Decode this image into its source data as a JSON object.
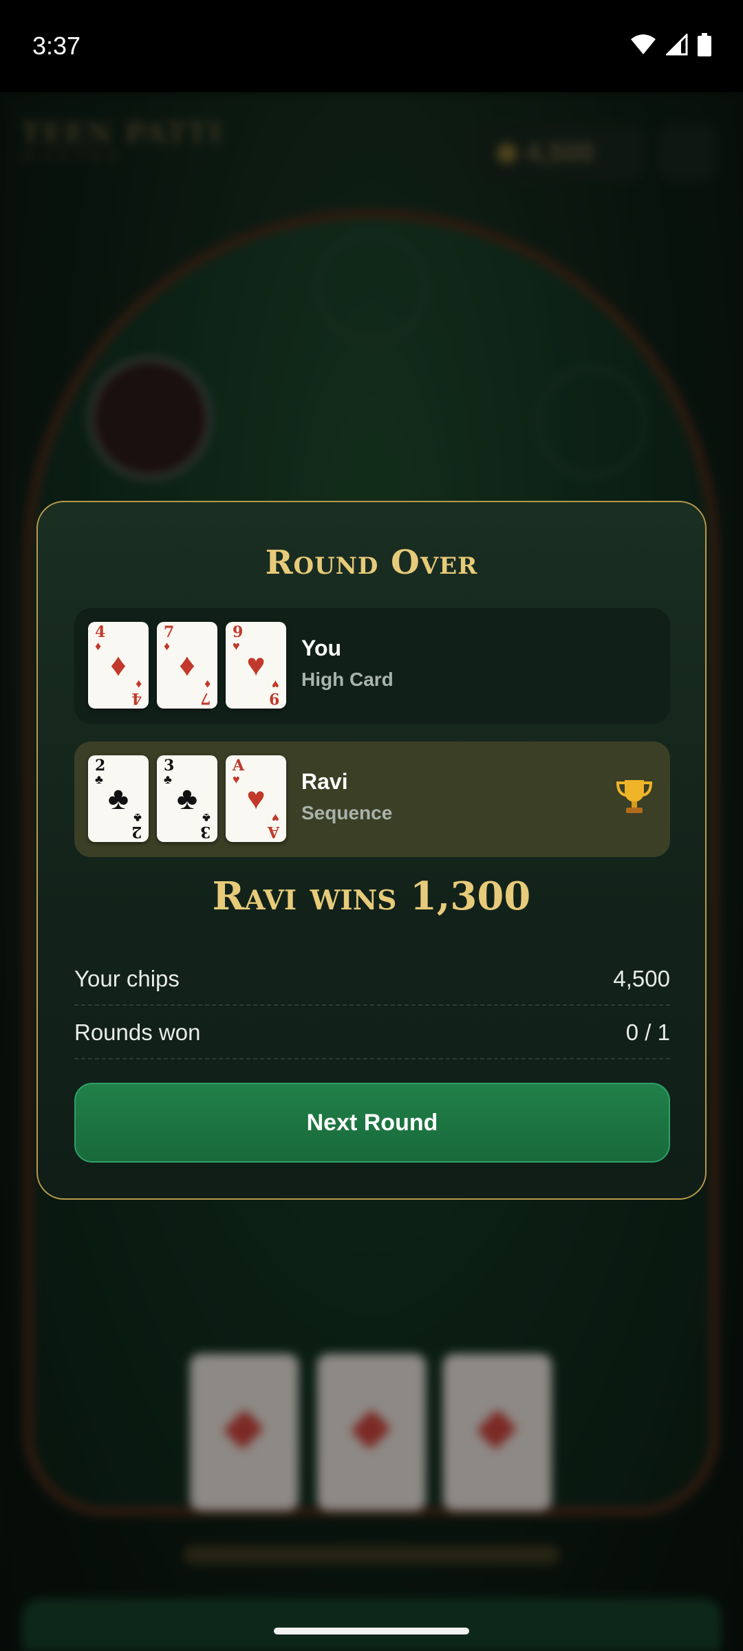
{
  "status_bar": {
    "time": "3:37"
  },
  "modal": {
    "title": "Round Over",
    "hands": [
      {
        "player": "You",
        "hand_type": "High Card",
        "winner": false,
        "cards": [
          {
            "rank": "4",
            "suit": "♦",
            "color": "red"
          },
          {
            "rank": "7",
            "suit": "♦",
            "color": "red"
          },
          {
            "rank": "9",
            "suit": "♥",
            "color": "red"
          }
        ]
      },
      {
        "player": "Ravi",
        "hand_type": "Sequence",
        "winner": true,
        "winner_icon": "trophy-icon",
        "cards": [
          {
            "rank": "2",
            "suit": "♣",
            "color": "black"
          },
          {
            "rank": "3",
            "suit": "♣",
            "color": "black"
          },
          {
            "rank": "A",
            "suit": "♥",
            "color": "red"
          }
        ]
      }
    ],
    "result": "Ravi wins 1,300",
    "stats": {
      "chips_label": "Your chips",
      "chips_value": "4,500",
      "rounds_label": "Rounds won",
      "rounds_value": "0 / 1"
    },
    "next_button": "Next Round"
  },
  "colors": {
    "gold": "#e7cb7a",
    "green_button": "#218048",
    "card_red": "#c0392b"
  }
}
